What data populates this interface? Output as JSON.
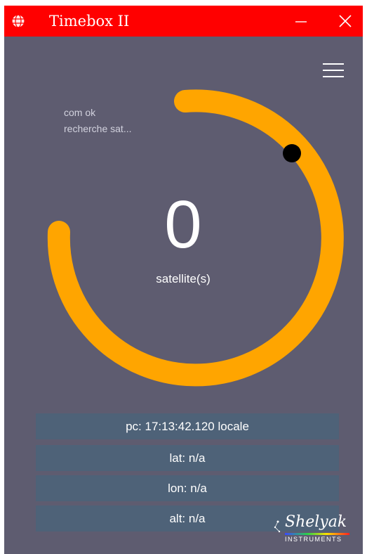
{
  "titlebar": {
    "title": "Timebox II",
    "app_icon": "globe-icon",
    "minimize_icon": "minimize-icon",
    "close_icon": "close-icon"
  },
  "toolbar": {
    "menu_icon": "hamburger-menu-icon"
  },
  "status": {
    "line1": "com ok",
    "line2": "recherche sat..."
  },
  "satellites": {
    "count": "0",
    "label": "satellite(s)"
  },
  "info": {
    "pc": "pc: 17:13:42.120 locale",
    "lat": "lat: n/a",
    "lon": "lon: n/a",
    "alt": "alt: n/a"
  },
  "logo": {
    "name": "Shelyak",
    "subtitle": "INSTRUMENTS"
  },
  "colors": {
    "titlebar": "#ff0000",
    "background": "#5e5c70",
    "ring": "#ffa500",
    "info_row": "#4e6278"
  }
}
